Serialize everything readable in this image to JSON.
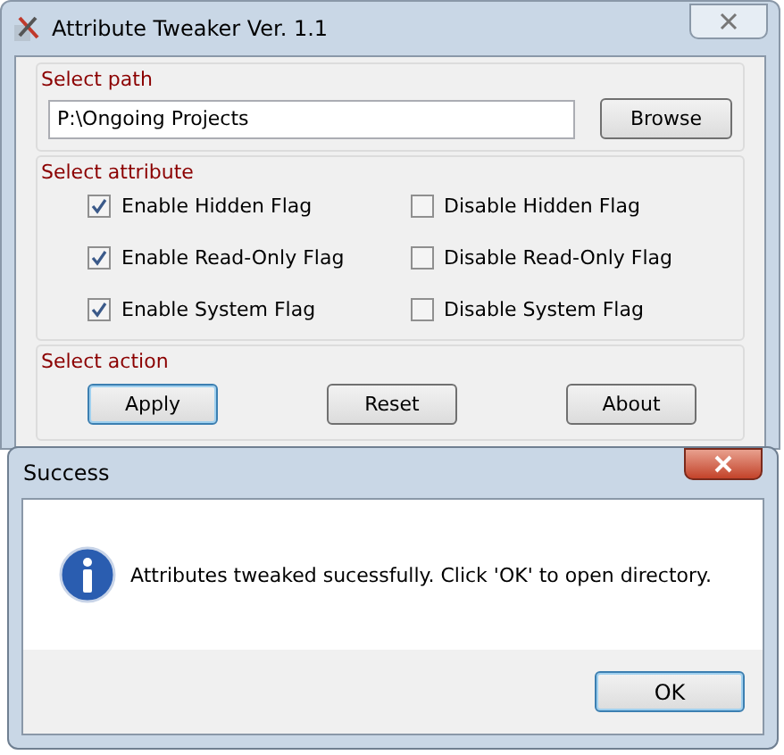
{
  "window": {
    "title": "Attribute Tweaker Ver. 1.1"
  },
  "path_group": {
    "label": "Select path",
    "path": "P:\\Ongoing Projects",
    "browse": "Browse"
  },
  "attribute_group": {
    "label": "Select attribute",
    "options": [
      {
        "label": "Enable Hidden Flag",
        "checked": true
      },
      {
        "label": "Disable Hidden Flag",
        "checked": false
      },
      {
        "label": "Enable Read-Only Flag",
        "checked": true
      },
      {
        "label": "Disable Read-Only Flag",
        "checked": false
      },
      {
        "label": "Enable System Flag",
        "checked": true
      },
      {
        "label": "Disable System Flag",
        "checked": false
      }
    ]
  },
  "action_group": {
    "label": "Select action",
    "buttons": [
      {
        "label": "Apply",
        "selected": true
      },
      {
        "label": "Reset",
        "selected": false
      },
      {
        "label": "About",
        "selected": false
      }
    ]
  },
  "dialog": {
    "title": "Success",
    "message": "Attributes tweaked sucessfully. Click 'OK' to open directory.",
    "button": "OK"
  }
}
